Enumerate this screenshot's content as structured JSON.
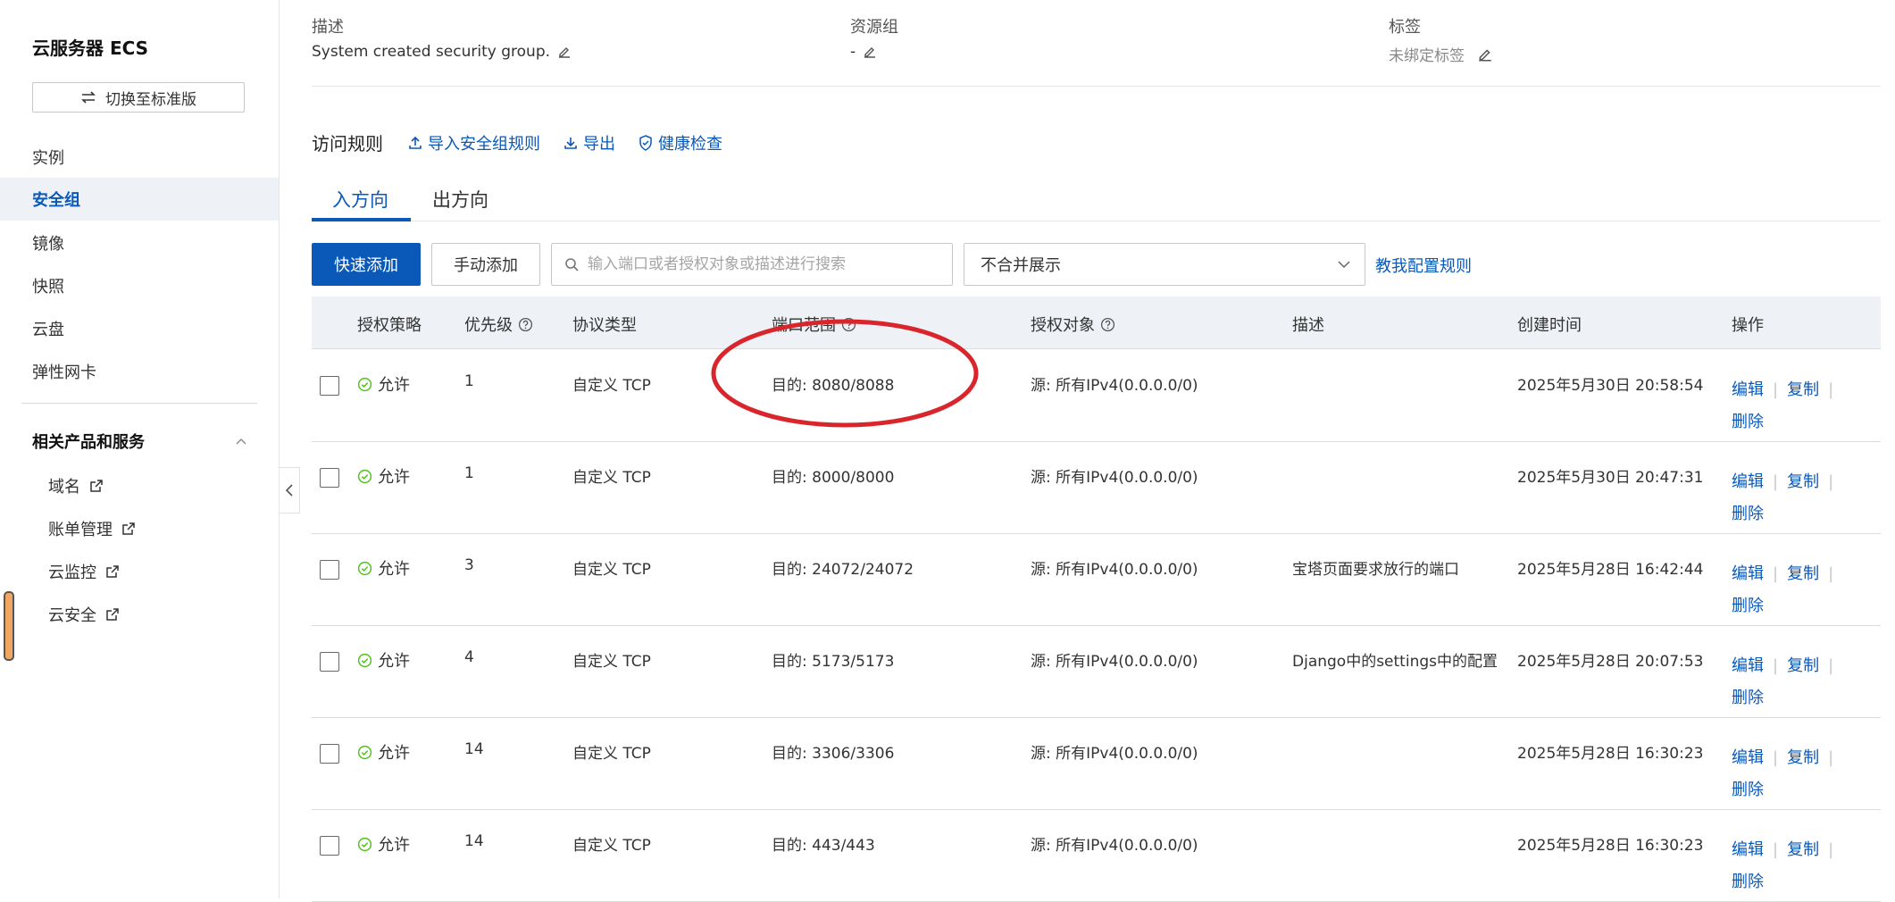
{
  "sidebar": {
    "title": "云服务器 ECS",
    "switch_label": "切换至标准版",
    "nav": [
      {
        "label": "实例",
        "active": false
      },
      {
        "label": "安全组",
        "active": true
      },
      {
        "label": "镜像",
        "active": false
      },
      {
        "label": "快照",
        "active": false
      },
      {
        "label": "云盘",
        "active": false
      },
      {
        "label": "弹性网卡",
        "active": false
      }
    ],
    "section_title": "相关产品和服务",
    "sub_items": [
      "域名",
      "账单管理",
      "云监控",
      "云安全"
    ]
  },
  "info": {
    "desc_label": "描述",
    "desc_value": "System created security group.",
    "rg_label": "资源组",
    "rg_value": "-",
    "tag_label": "标签",
    "tag_value": "未绑定标签"
  },
  "rules": {
    "title": "访问规则",
    "import_label": "导入安全组规则",
    "export_label": "导出",
    "health_label": "健康检查",
    "tabs": [
      "入方向",
      "出方向"
    ]
  },
  "toolbar": {
    "quick_add": "快速添加",
    "manual_add": "手动添加",
    "search_placeholder": "输入端口或者授权对象或描述进行搜索",
    "merge_select": "不合并展示",
    "help_link": "教我配置规则"
  },
  "table": {
    "headers": [
      "授权策略",
      "优先级",
      "协议类型",
      "端口范围",
      "授权对象",
      "描述",
      "创建时间",
      "操作"
    ],
    "rows": [
      {
        "policy": "允许",
        "priority": "1",
        "protocol": "自定义 TCP",
        "port": "目的: 8080/8088",
        "object": "源: 所有IPv4(0.0.0.0/0)",
        "desc": "",
        "time": "2025年5月30日 20:58:54"
      },
      {
        "policy": "允许",
        "priority": "1",
        "protocol": "自定义 TCP",
        "port": "目的: 8000/8000",
        "object": "源: 所有IPv4(0.0.0.0/0)",
        "desc": "",
        "time": "2025年5月30日 20:47:31"
      },
      {
        "policy": "允许",
        "priority": "3",
        "protocol": "自定义 TCP",
        "port": "目的: 24072/24072",
        "object": "源: 所有IPv4(0.0.0.0/0)",
        "desc": "宝塔页面要求放行的端口",
        "time": "2025年5月28日 16:42:44"
      },
      {
        "policy": "允许",
        "priority": "4",
        "protocol": "自定义 TCP",
        "port": "目的: 5173/5173",
        "object": "源: 所有IPv4(0.0.0.0/0)",
        "desc": "Django中的settings中的配置",
        "time": "2025年5月28日 20:07:53"
      },
      {
        "policy": "允许",
        "priority": "14",
        "protocol": "自定义 TCP",
        "port": "目的: 3306/3306",
        "object": "源: 所有IPv4(0.0.0.0/0)",
        "desc": "",
        "time": "2025年5月28日 16:30:23"
      },
      {
        "policy": "允许",
        "priority": "14",
        "protocol": "自定义 TCP",
        "port": "目的: 443/443",
        "object": "源: 所有IPv4(0.0.0.0/0)",
        "desc": "",
        "time": "2025年5月28日 16:30:23"
      }
    ],
    "op_edit": "编辑",
    "op_copy": "复制",
    "op_delete": "删除"
  },
  "colors": {
    "accent": "#0a59b8",
    "success": "#52c41a",
    "annotation": "#d9262c"
  }
}
